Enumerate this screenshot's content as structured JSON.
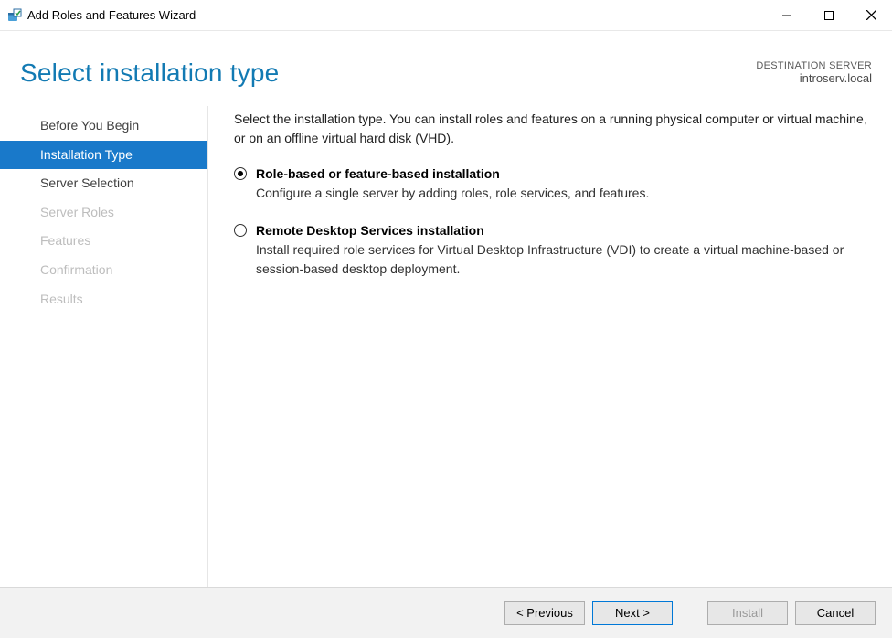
{
  "window": {
    "title": "Add Roles and Features Wizard"
  },
  "header": {
    "heading": "Select installation type",
    "destination_label": "DESTINATION SERVER",
    "destination_value": "introserv.local"
  },
  "sidebar": {
    "items": [
      {
        "label": "Before You Begin",
        "state": "normal"
      },
      {
        "label": "Installation Type",
        "state": "active"
      },
      {
        "label": "Server Selection",
        "state": "normal"
      },
      {
        "label": "Server Roles",
        "state": "disabled"
      },
      {
        "label": "Features",
        "state": "disabled"
      },
      {
        "label": "Confirmation",
        "state": "disabled"
      },
      {
        "label": "Results",
        "state": "disabled"
      }
    ]
  },
  "main": {
    "intro": "Select the installation type. You can install roles and features on a running physical computer or virtual machine, or on an offline virtual hard disk (VHD).",
    "options": [
      {
        "title": "Role-based or feature-based installation",
        "description": "Configure a single server by adding roles, role services, and features.",
        "selected": true
      },
      {
        "title": "Remote Desktop Services installation",
        "description": "Install required role services for Virtual Desktop Infrastructure (VDI) to create a virtual machine-based or session-based desktop deployment.",
        "selected": false
      }
    ]
  },
  "footer": {
    "previous": "< Previous",
    "next": "Next >",
    "install": "Install",
    "cancel": "Cancel"
  }
}
